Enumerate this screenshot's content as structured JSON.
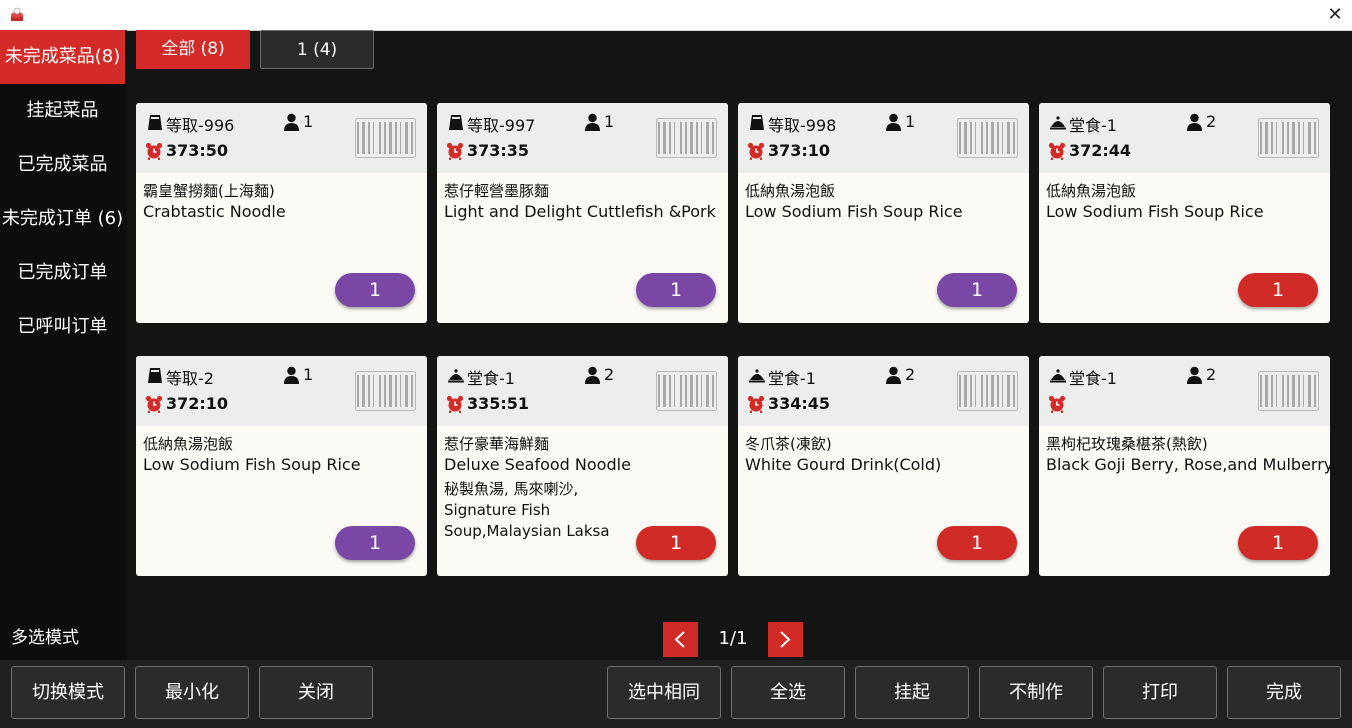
{
  "window": {
    "close_symbol": "✕"
  },
  "sidebar": {
    "items": [
      {
        "label": "未完成菜品(8)",
        "active": true
      },
      {
        "label": "挂起菜品"
      },
      {
        "label": "已完成菜品"
      },
      {
        "label": "未完成订单 (6)"
      },
      {
        "label": "已完成订单"
      },
      {
        "label": "已呼叫订单"
      }
    ],
    "multi_select_label": "多选模式"
  },
  "tabs": [
    {
      "label": "全部 (8)",
      "active": true
    },
    {
      "label": "1 (4)"
    }
  ],
  "cards": [
    {
      "order_type": "takeaway",
      "order_label": "等取-996",
      "guests": "1",
      "timer": "373:50",
      "dish_cn": "霸皇蟹撈麵(上海麵)",
      "dish_en": "Crabtastic Noodle",
      "note": "",
      "qty": "1",
      "qty_color": "purple"
    },
    {
      "order_type": "takeaway",
      "order_label": "等取-997",
      "guests": "1",
      "timer": "373:35",
      "dish_cn": "惹仔輕營墨豚麵",
      "dish_en": "Light and Delight Cuttlefish &Pork",
      "note": "",
      "qty": "1",
      "qty_color": "purple"
    },
    {
      "order_type": "takeaway",
      "order_label": "等取-998",
      "guests": "1",
      "timer": "373:10",
      "dish_cn": "低納魚湯泡飯",
      "dish_en": "Low Sodium Fish Soup Rice",
      "note": "",
      "qty": "1",
      "qty_color": "purple"
    },
    {
      "order_type": "dine-in",
      "order_label": "堂食-1",
      "guests": "2",
      "timer": "372:44",
      "dish_cn": "低納魚湯泡飯",
      "dish_en": "Low Sodium Fish Soup Rice",
      "note": "",
      "qty": "1",
      "qty_color": "red"
    },
    {
      "order_type": "takeaway",
      "order_label": "等取-2",
      "guests": "1",
      "timer": "372:10",
      "dish_cn": "低納魚湯泡飯",
      "dish_en": "Low Sodium Fish Soup Rice",
      "note": "",
      "qty": "1",
      "qty_color": "purple"
    },
    {
      "order_type": "dine-in",
      "order_label": "堂食-1",
      "guests": "2",
      "timer": "335:51",
      "dish_cn": "惹仔豪華海鮮麵",
      "dish_en": "Deluxe Seafood Noodle",
      "note": " 秘製魚湯, 馬來喇沙, Signature Fish Soup,Malaysian Laksa",
      "qty": "1",
      "qty_color": "red"
    },
    {
      "order_type": "dine-in",
      "order_label": "堂食-1",
      "guests": "2",
      "timer": "334:45",
      "dish_cn": "冬爪茶(凍飲)",
      "dish_en": "White Gourd Drink(Cold)",
      "note": "",
      "qty": "1",
      "qty_color": "red"
    },
    {
      "order_type": "dine-in",
      "order_label": "堂食-1",
      "guests": "2",
      "timer": "",
      "dish_cn": "黑枸杞玫瑰桑椹茶(熱飲)",
      "dish_en": "Black Goji Berry, Rose,and Mulberry",
      "note": "",
      "qty": "1",
      "qty_color": "red"
    }
  ],
  "pagination": {
    "label": "1/1"
  },
  "bottom_bar": {
    "left_buttons": [
      "切换模式",
      "最小化",
      "关闭"
    ],
    "right_buttons": [
      "选中相同",
      "全选",
      "挂起",
      "不制作",
      "打印",
      "完成"
    ]
  },
  "colors": {
    "accent_red": "#d42a28",
    "qty_purple": "#7a47a6",
    "qty_red": "#d12b28",
    "background": "#141414"
  },
  "icons": {
    "app": "chef-hat-icon",
    "takeaway": "takeaway-bag-icon",
    "dine_in": "serving-cloche-icon",
    "guests": "person-icon",
    "barcode": "barcode-icon",
    "timer": "alarm-clock-icon"
  }
}
